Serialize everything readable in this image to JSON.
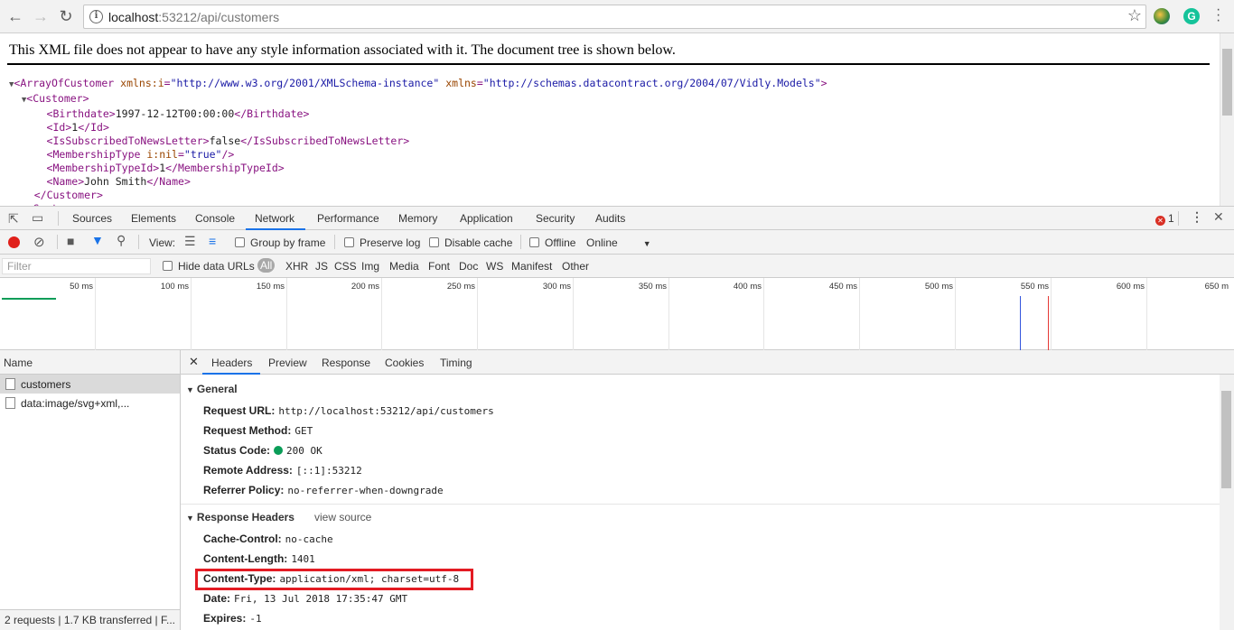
{
  "browser": {
    "url_host": "localhost",
    "url_path": ":53212/api/customers"
  },
  "xml_page": {
    "notice": "This XML file does not appear to have any style information associated with it. The document tree is shown below.",
    "root_tag": "ArrayOfCustomer",
    "root_attr1_name": "xmlns:i",
    "root_attr1_value": "\"http://www.w3.org/2001/XMLSchema-instance\"",
    "root_attr2_name": "xmlns",
    "root_attr2_value": "\"http://schemas.datacontract.org/2004/07/Vidly.Models\"",
    "customer_tag": "Customer",
    "birthdate_tag": "Birthdate",
    "birthdate": "1997-12-12T00:00:00",
    "id_tag": "Id",
    "id": "1",
    "subscribed_tag": "IsSubscribedToNewsLetter",
    "subscribed": "false",
    "membershiptype_tag": "MembershipType",
    "membershiptype_attr": "i:nil",
    "membershiptype_attr_value": "\"true\"",
    "membershiptypeid_tag": "MembershipTypeId",
    "membershiptypeid": "1",
    "name_tag": "Name",
    "name": "John Smith"
  },
  "devtools": {
    "tabs": [
      "Sources",
      "Elements",
      "Console",
      "Network",
      "Performance",
      "Memory",
      "Application",
      "Security",
      "Audits"
    ],
    "error_count": "1",
    "toolbar": {
      "view_label": "View:",
      "group_by_frame": "Group by frame",
      "preserve_log": "Preserve log",
      "disable_cache": "Disable cache",
      "offline": "Offline",
      "throttle": "Online"
    },
    "filter": {
      "placeholder": "Filter",
      "hide_data_urls": "Hide data URLs",
      "types": [
        "All",
        "XHR",
        "JS",
        "CSS",
        "Img",
        "Media",
        "Font",
        "Doc",
        "WS",
        "Manifest",
        "Other"
      ]
    },
    "timeline_ticks": [
      "50 ms",
      "100 ms",
      "150 ms",
      "200 ms",
      "250 ms",
      "300 ms",
      "350 ms",
      "400 ms",
      "450 ms",
      "500 ms",
      "550 ms",
      "600 ms",
      "650 m"
    ],
    "requests": {
      "header": "Name",
      "items": [
        "customers",
        "data:image/svg+xml,..."
      ],
      "status": "2 requests  |  1.7 KB transferred  |  F..."
    },
    "detail_tabs": [
      "Headers",
      "Preview",
      "Response",
      "Cookies",
      "Timing"
    ],
    "general": {
      "title": "General",
      "request_url_k": "Request URL:",
      "request_url_v": "http://localhost:53212/api/customers",
      "request_method_k": "Request Method:",
      "request_method_v": "GET",
      "status_code_k": "Status Code:",
      "status_code_v": "200 OK",
      "remote_address_k": "Remote Address:",
      "remote_address_v": "[::1]:53212",
      "referrer_policy_k": "Referrer Policy:",
      "referrer_policy_v": "no-referrer-when-downgrade"
    },
    "response_headers": {
      "title": "Response Headers",
      "view_source": "view source",
      "cache_control_k": "Cache-Control:",
      "cache_control_v": "no-cache",
      "content_length_k": "Content-Length:",
      "content_length_v": "1401",
      "content_type_k": "Content-Type:",
      "content_type_v": "application/xml; charset=utf-8",
      "date_k": "Date:",
      "date_v": "Fri, 13 Jul 2018 17:35:47 GMT",
      "expires_k": "Expires:",
      "expires_v": "-1"
    }
  }
}
